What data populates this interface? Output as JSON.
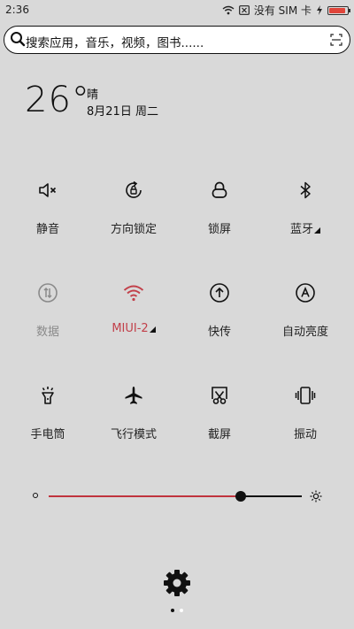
{
  "status_bar": {
    "time": "2:36",
    "sim_text": "没有 SIM 卡",
    "battery_level": 0.9,
    "icons": [
      "wifi-icon",
      "sim-absent-icon",
      "charging-icon",
      "battery-icon"
    ]
  },
  "search": {
    "placeholder": "搜索应用，音乐，视频，图书......",
    "left_icon": "search-icon",
    "right_icon": "scan-icon"
  },
  "weather": {
    "temperature": "26°",
    "condition": "晴",
    "date": "8月21日 周二"
  },
  "toggles": [
    {
      "label": "静音",
      "icon": "mute-icon",
      "state": "off"
    },
    {
      "label": "方向锁定",
      "icon": "rotation-lock-icon",
      "state": "off"
    },
    {
      "label": "锁屏",
      "icon": "lock-icon",
      "state": "off"
    },
    {
      "label": "蓝牙",
      "icon": "bluetooth-icon",
      "state": "off",
      "has_submenu": true
    },
    {
      "label": "数据",
      "icon": "mobile-data-icon",
      "state": "disabled"
    },
    {
      "label": "MIUI-2",
      "icon": "wifi-icon",
      "state": "on",
      "has_submenu": true
    },
    {
      "label": "快传",
      "icon": "mi-drop-icon",
      "state": "off"
    },
    {
      "label": "自动亮度",
      "icon": "auto-brightness-icon",
      "state": "off"
    },
    {
      "label": "手电筒",
      "icon": "flashlight-icon",
      "state": "off"
    },
    {
      "label": "飞行模式",
      "icon": "airplane-icon",
      "state": "off"
    },
    {
      "label": "截屏",
      "icon": "screenshot-icon",
      "state": "off"
    },
    {
      "label": "振动",
      "icon": "vibrate-icon",
      "state": "off"
    }
  ],
  "brightness": {
    "level": 0.76
  },
  "bottom": {
    "settings_icon": "gear-icon",
    "page_count": 2,
    "current_page": 0
  },
  "colors": {
    "background": "#d9d9d9",
    "accent_red": "#c2404a",
    "text": "#222222",
    "dim_text": "#8a8a8a"
  }
}
